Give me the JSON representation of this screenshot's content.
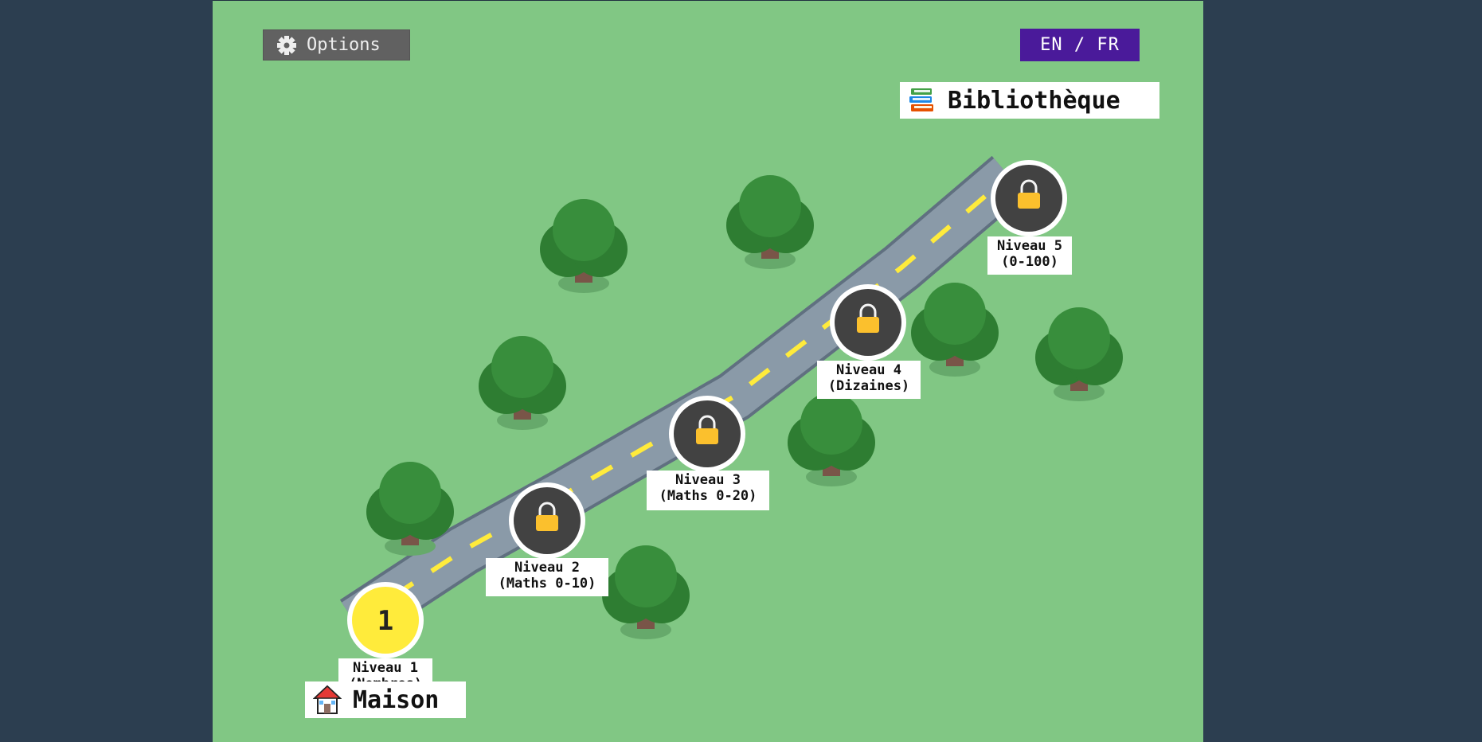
{
  "toolbar": {
    "options_label": "Options",
    "language_label": "EN / FR"
  },
  "destinations": {
    "library_label": "Bibliothèque",
    "home_label": "Maison"
  },
  "levels": [
    {
      "title": "Niveau 1",
      "subtitle": "(Nombres)",
      "badge": "1",
      "locked": false
    },
    {
      "title": "Niveau 2",
      "subtitle": "(Maths 0-10)",
      "locked": true
    },
    {
      "title": "Niveau 3",
      "subtitle": "(Maths 0-20)",
      "locked": true
    },
    {
      "title": "Niveau 4",
      "subtitle": "(Dizaines)",
      "locked": true
    },
    {
      "title": "Niveau 5",
      "subtitle": "(0-100)",
      "locked": true
    }
  ],
  "colors": {
    "grass": "#81c784",
    "road": "#8a9aa8",
    "road_border": "#607080",
    "lane_marking": "#ffeb3b",
    "current_level": "#ffeb3b",
    "locked_level": "#424242",
    "lock": "#fbc02d",
    "tree_leaves": "#388e3c",
    "tree_trunk": "#795548",
    "language_button": "#4a1a9a"
  },
  "icons": {
    "options": "gear-icon",
    "library": "books-icon",
    "home": "house-icon",
    "locked": "lock-icon"
  }
}
